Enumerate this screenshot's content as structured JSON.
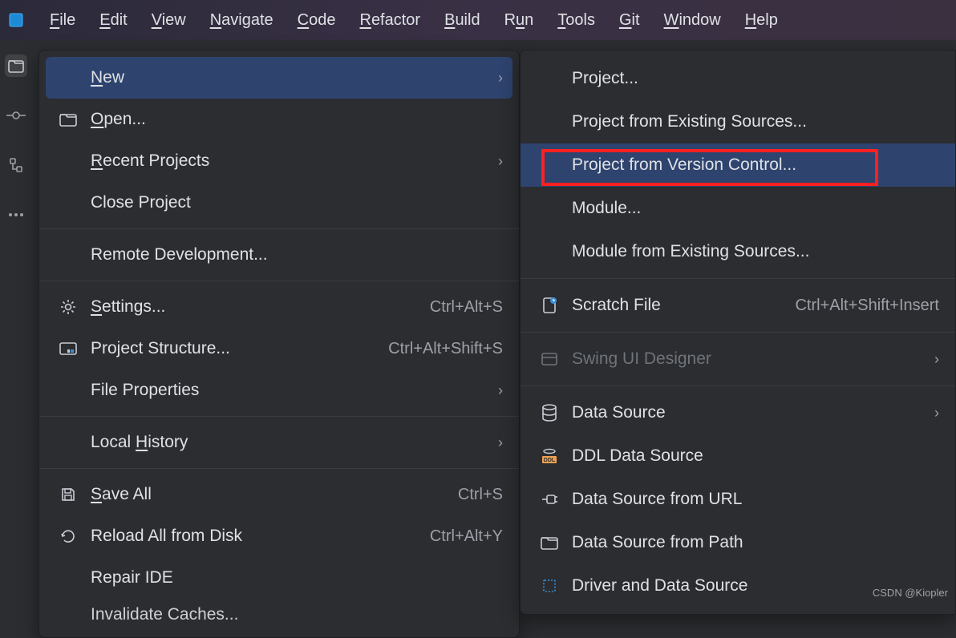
{
  "menubar": {
    "items": [
      {
        "label": "File",
        "mnemonic": "F"
      },
      {
        "label": "Edit",
        "mnemonic": "E"
      },
      {
        "label": "View",
        "mnemonic": "V"
      },
      {
        "label": "Navigate",
        "mnemonic": "N"
      },
      {
        "label": "Code",
        "mnemonic": "C"
      },
      {
        "label": "Refactor",
        "mnemonic": "R"
      },
      {
        "label": "Build",
        "mnemonic": "B"
      },
      {
        "label": "Run",
        "mnemonic": "u"
      },
      {
        "label": "Tools",
        "mnemonic": "T"
      },
      {
        "label": "Git",
        "mnemonic": "G"
      },
      {
        "label": "Window",
        "mnemonic": "W"
      },
      {
        "label": "Help",
        "mnemonic": "H"
      }
    ]
  },
  "file_menu": {
    "new": {
      "label": "New",
      "mnemonic": "N"
    },
    "open": {
      "label": "Open...",
      "mnemonic": "O"
    },
    "recent": {
      "label": "Recent Projects",
      "mnemonic": "R"
    },
    "close": {
      "label": "Close Project"
    },
    "remote": {
      "label": "Remote Development..."
    },
    "settings": {
      "label": "Settings...",
      "mnemonic": "S",
      "shortcut": "Ctrl+Alt+S"
    },
    "structure": {
      "label": "Project Structure...",
      "shortcut": "Ctrl+Alt+Shift+S"
    },
    "fileprops": {
      "label": "File Properties"
    },
    "localhist": {
      "label": "Local History",
      "mnemonic": "H"
    },
    "saveall": {
      "label": "Save All",
      "mnemonic": "S",
      "shortcut": "Ctrl+S"
    },
    "reload": {
      "label": "Reload All from Disk",
      "shortcut": "Ctrl+Alt+Y"
    },
    "repair": {
      "label": "Repair IDE"
    },
    "invalidate": {
      "label": "Invalidate Caches..."
    }
  },
  "new_submenu": {
    "project": {
      "label": "Project..."
    },
    "project_existing": {
      "label": "Project from Existing Sources..."
    },
    "project_vcs": {
      "label": "Project from Version Control..."
    },
    "module": {
      "label": "Module..."
    },
    "module_existing": {
      "label": "Module from Existing Sources..."
    },
    "scratch": {
      "label": "Scratch File",
      "shortcut": "Ctrl+Alt+Shift+Insert"
    },
    "swing": {
      "label": "Swing UI Designer"
    },
    "datasource": {
      "label": "Data Source"
    },
    "ddl": {
      "label": "DDL Data Source"
    },
    "ds_url": {
      "label": "Data Source from URL"
    },
    "ds_path": {
      "label": "Data Source from Path"
    },
    "driver_ds": {
      "label": "Driver and Data Source"
    }
  },
  "watermark": "CSDN @Kiopler"
}
